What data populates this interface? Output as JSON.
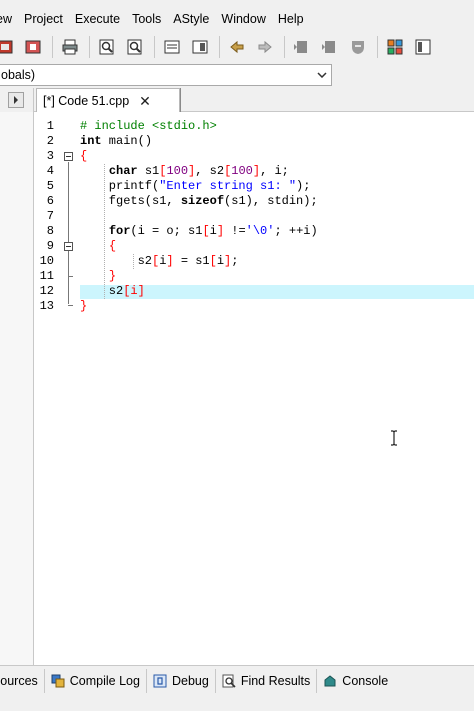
{
  "menu": [
    "ew",
    "Project",
    "Execute",
    "Tools",
    "AStyle",
    "Window",
    "Help"
  ],
  "toolbar": {
    "icons": [
      "compile-icon",
      "run-icon",
      "print-icon",
      "find-icon",
      "replace-icon",
      "toggle-view-icon",
      "fullscreen-icon",
      "undo-icon",
      "redo-icon",
      "bookmark-back-icon",
      "bookmark-next-icon",
      "shield-icon",
      "grid-icon",
      "class-icon"
    ]
  },
  "class_combo": {
    "value": "obals)"
  },
  "tabs": {
    "active_label": "[*] Code 51.cpp",
    "close_glyph": "✕"
  },
  "editor": {
    "line_numbers": [
      "1",
      "2",
      "3",
      "4",
      "5",
      "6",
      "7",
      "8",
      "9",
      "10",
      "11",
      "12",
      "13"
    ],
    "lines": [
      [
        {
          "t": "pre",
          "v": "# include <stdio.h>"
        }
      ],
      [
        {
          "t": "kw",
          "v": "int"
        },
        {
          "t": "id",
          "v": " main()"
        }
      ],
      [
        {
          "t": "sym",
          "v": "{"
        }
      ],
      [
        {
          "t": "id",
          "v": "    "
        },
        {
          "t": "kw",
          "v": "char"
        },
        {
          "t": "id",
          "v": " s1"
        },
        {
          "t": "sym",
          "v": "["
        },
        {
          "t": "num",
          "v": "100"
        },
        {
          "t": "sym",
          "v": "]"
        },
        {
          "t": "id",
          "v": ", s2"
        },
        {
          "t": "sym",
          "v": "["
        },
        {
          "t": "num",
          "v": "100"
        },
        {
          "t": "sym",
          "v": "]"
        },
        {
          "t": "id",
          "v": ", i;"
        }
      ],
      [
        {
          "t": "id",
          "v": "    printf("
        },
        {
          "t": "str",
          "v": "\"Enter string s1: \""
        },
        {
          "t": "id",
          "v": ");"
        }
      ],
      [
        {
          "t": "id",
          "v": "    fgets(s1, "
        },
        {
          "t": "kw",
          "v": "sizeof"
        },
        {
          "t": "id",
          "v": "(s1), stdin);"
        }
      ],
      [
        {
          "t": "id",
          "v": ""
        }
      ],
      [
        {
          "t": "id",
          "v": "    "
        },
        {
          "t": "kw",
          "v": "for"
        },
        {
          "t": "id",
          "v": "(i = o; s1"
        },
        {
          "t": "sym",
          "v": "["
        },
        {
          "t": "id",
          "v": "i"
        },
        {
          "t": "sym",
          "v": "]"
        },
        {
          "t": "id",
          "v": " !="
        },
        {
          "t": "str",
          "v": "'\\0'"
        },
        {
          "t": "id",
          "v": "; ++i)"
        }
      ],
      [
        {
          "t": "id",
          "v": "    "
        },
        {
          "t": "sym",
          "v": "{"
        }
      ],
      [
        {
          "t": "id",
          "v": "        s2"
        },
        {
          "t": "sym",
          "v": "["
        },
        {
          "t": "id",
          "v": "i"
        },
        {
          "t": "sym",
          "v": "]"
        },
        {
          "t": "id",
          "v": " = s1"
        },
        {
          "t": "sym",
          "v": "["
        },
        {
          "t": "id",
          "v": "i"
        },
        {
          "t": "sym",
          "v": "]"
        },
        {
          "t": "id",
          "v": ";"
        }
      ],
      [
        {
          "t": "id",
          "v": "    "
        },
        {
          "t": "sym",
          "v": "}"
        }
      ],
      [
        {
          "t": "id",
          "v": "    s2"
        },
        {
          "t": "sym",
          "v": "[i]"
        }
      ],
      [
        {
          "t": "sym",
          "v": "}"
        }
      ]
    ]
  },
  "bottom_tabs": [
    {
      "label": "sources",
      "icon": "resources-icon"
    },
    {
      "label": "Compile Log",
      "icon": "compile-log-icon"
    },
    {
      "label": "Debug",
      "icon": "debug-icon"
    },
    {
      "label": "Find Results",
      "icon": "find-results-icon"
    },
    {
      "label": "Console",
      "icon": "console-icon"
    }
  ],
  "colors": {
    "active_line": "#ccf5fd",
    "preprocessor": "#008000",
    "string": "#0000ff",
    "number": "#800080",
    "symbol": "#ff0000"
  }
}
